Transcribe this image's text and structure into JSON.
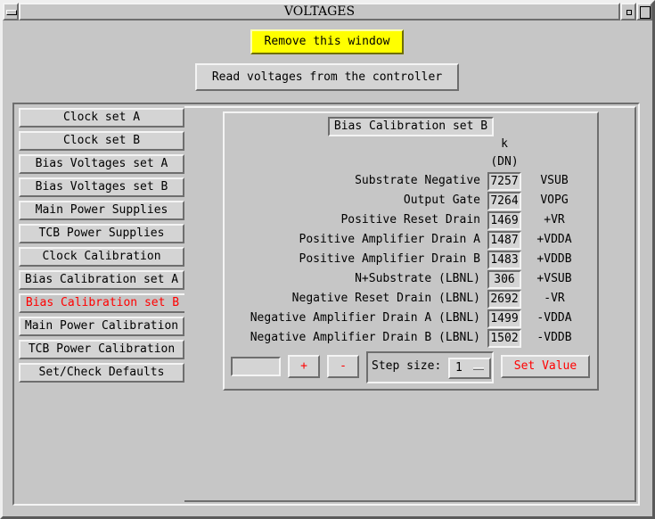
{
  "window": {
    "title": "VOLTAGES"
  },
  "top_buttons": {
    "remove": "Remove this window",
    "read": "Read voltages from the controller"
  },
  "nav": {
    "items": [
      {
        "label": "Clock set A"
      },
      {
        "label": "Clock set B"
      },
      {
        "label": "Bias Voltages set A"
      },
      {
        "label": "Bias Voltages set B"
      },
      {
        "label": "Main Power Supplies"
      },
      {
        "label": "TCB Power Supplies"
      },
      {
        "label": "Clock Calibration"
      },
      {
        "label": "Bias Calibration set A"
      },
      {
        "label": "Bias Calibration set B",
        "active": true
      },
      {
        "label": "Main Power Calibration"
      },
      {
        "label": "TCB Power Calibration"
      },
      {
        "label": "Set/Check Defaults"
      }
    ]
  },
  "calibration": {
    "title": "Bias Calibration set B",
    "col_header_k": "k",
    "col_header_unit": "(DN)",
    "rows": [
      {
        "label": "Substrate Negative",
        "value": "7257",
        "symbol": "VSUB"
      },
      {
        "label": "Output Gate",
        "value": "7264",
        "symbol": "VOPG"
      },
      {
        "label": "Positive Reset Drain",
        "value": "1469",
        "symbol": "+VR"
      },
      {
        "label": "Positive Amplifier Drain A",
        "value": "1487",
        "symbol": "+VDDA"
      },
      {
        "label": "Positive Amplifier Drain B",
        "value": "1483",
        "symbol": "+VDDB"
      },
      {
        "label": "N+Substrate (LBNL)",
        "value": "306",
        "symbol": "+VSUB"
      },
      {
        "label": "Negative Reset Drain (LBNL)",
        "value": "2692",
        "symbol": "-VR"
      },
      {
        "label": "Negative Amplifier Drain A (LBNL)",
        "value": "1499",
        "symbol": "-VDDA"
      },
      {
        "label": "Negative Amplifier Drain B (LBNL)",
        "value": "1502",
        "symbol": "-VDDB"
      }
    ]
  },
  "controls": {
    "step_input_value": "",
    "plus": "+",
    "minus": "-",
    "step_label": "Step size:",
    "step_value": "1",
    "set_value": "Set Value"
  },
  "colors": {
    "background": "#c6c6c6",
    "remove_button": "#ffff00",
    "active_text": "#ff0000"
  }
}
